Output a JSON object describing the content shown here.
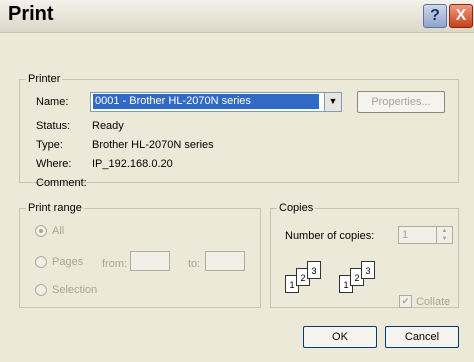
{
  "window": {
    "title": "Print",
    "help_label": "?",
    "close_label": "X"
  },
  "printer": {
    "legend": "Printer",
    "name_label": "Name:",
    "name_value": "0001 - Brother HL-2070N series",
    "properties_label": "Properties...",
    "status_label": "Status:",
    "status_value": "Ready",
    "type_label": "Type:",
    "type_value": "Brother HL-2070N series",
    "where_label": "Where:",
    "where_value": "IP_192.168.0.20",
    "comment_label": "Comment:",
    "comment_value": ""
  },
  "print_range": {
    "legend": "Print range",
    "all_label": "All",
    "pages_label": "Pages",
    "from_label": "from:",
    "to_label": "to:",
    "selection_label": "Selection"
  },
  "copies": {
    "legend": "Copies",
    "number_label": "Number of copies:",
    "number_value": "1",
    "collate_label": "Collate",
    "page_numbers": [
      "1",
      "2",
      "3"
    ]
  },
  "buttons": {
    "ok": "OK",
    "cancel": "Cancel"
  }
}
